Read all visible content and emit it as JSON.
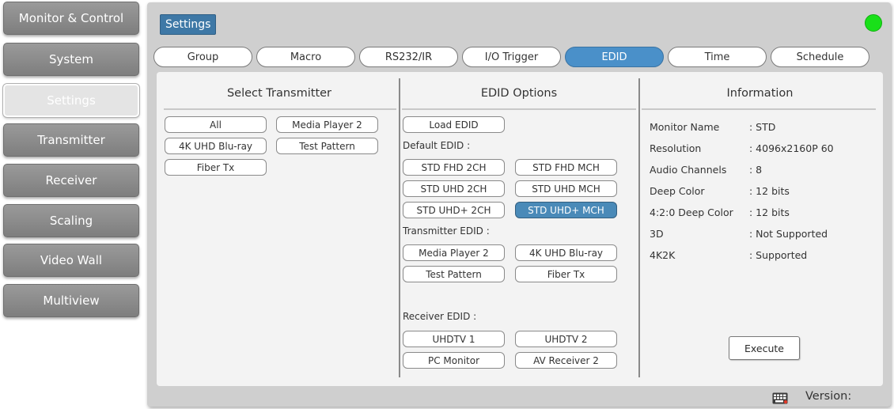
{
  "sidebar": {
    "items": [
      {
        "label": "Monitor & Control",
        "active": false
      },
      {
        "label": "System",
        "active": false
      },
      {
        "label": "Settings",
        "active": true
      },
      {
        "label": "Transmitter",
        "active": false
      },
      {
        "label": "Receiver",
        "active": false
      },
      {
        "label": "Scaling",
        "active": false
      },
      {
        "label": "Video Wall",
        "active": false
      },
      {
        "label": "Multiview",
        "active": false
      }
    ]
  },
  "header": {
    "title": "Settings",
    "status_color": "#19e019"
  },
  "tabs": [
    {
      "label": "Group",
      "active": false
    },
    {
      "label": "Macro",
      "active": false
    },
    {
      "label": "RS232/IR",
      "active": false
    },
    {
      "label": "I/O Trigger",
      "active": false
    },
    {
      "label": "EDID",
      "active": true
    },
    {
      "label": "Time",
      "active": false
    },
    {
      "label": "Schedule",
      "active": false
    }
  ],
  "select_transmitter": {
    "title": "Select Transmitter",
    "buttons": [
      "All",
      "Media Player 2",
      "4K UHD Blu-ray",
      "Test Pattern",
      "Fiber Tx"
    ]
  },
  "edid_options": {
    "title": "EDID Options",
    "load_label": "Load EDID",
    "default_label": "Default EDID :",
    "default_buttons": [
      {
        "label": "STD FHD 2CH",
        "active": false
      },
      {
        "label": "STD FHD MCH",
        "active": false
      },
      {
        "label": "STD UHD 2CH",
        "active": false
      },
      {
        "label": "STD UHD MCH",
        "active": false
      },
      {
        "label": "STD UHD+ 2CH",
        "active": false
      },
      {
        "label": "STD UHD+ MCH",
        "active": true
      }
    ],
    "transmitter_label": "Transmitter EDID :",
    "transmitter_buttons": [
      "Media Player 2",
      "4K UHD Blu-ray",
      "Test Pattern",
      "Fiber Tx"
    ],
    "receiver_label": "Receiver EDID :",
    "receiver_buttons": [
      "UHDTV 1",
      "UHDTV 2",
      "PC Monitor",
      "AV Receiver 2"
    ]
  },
  "information": {
    "title": "Information",
    "rows": [
      {
        "key": "Monitor Name",
        "value": ": STD"
      },
      {
        "key": "Resolution",
        "value": ": 4096x2160P 60"
      },
      {
        "key": "Audio Channels",
        "value": ": 8"
      },
      {
        "key": "Deep Color",
        "value": ": 12 bits"
      },
      {
        "key": "4:2:0 Deep Color",
        "value": ": 12 bits"
      },
      {
        "key": "3D",
        "value": ": Not Supported"
      },
      {
        "key": "4K2K",
        "value": ": Supported"
      }
    ],
    "execute_label": "Execute"
  },
  "footer": {
    "version_label": "Version:",
    "icon": "keyboard-icon"
  },
  "colors": {
    "accent": "#4a90c9",
    "selected_button": "#4a8ab8",
    "sidebar": "#8a8a8a"
  }
}
